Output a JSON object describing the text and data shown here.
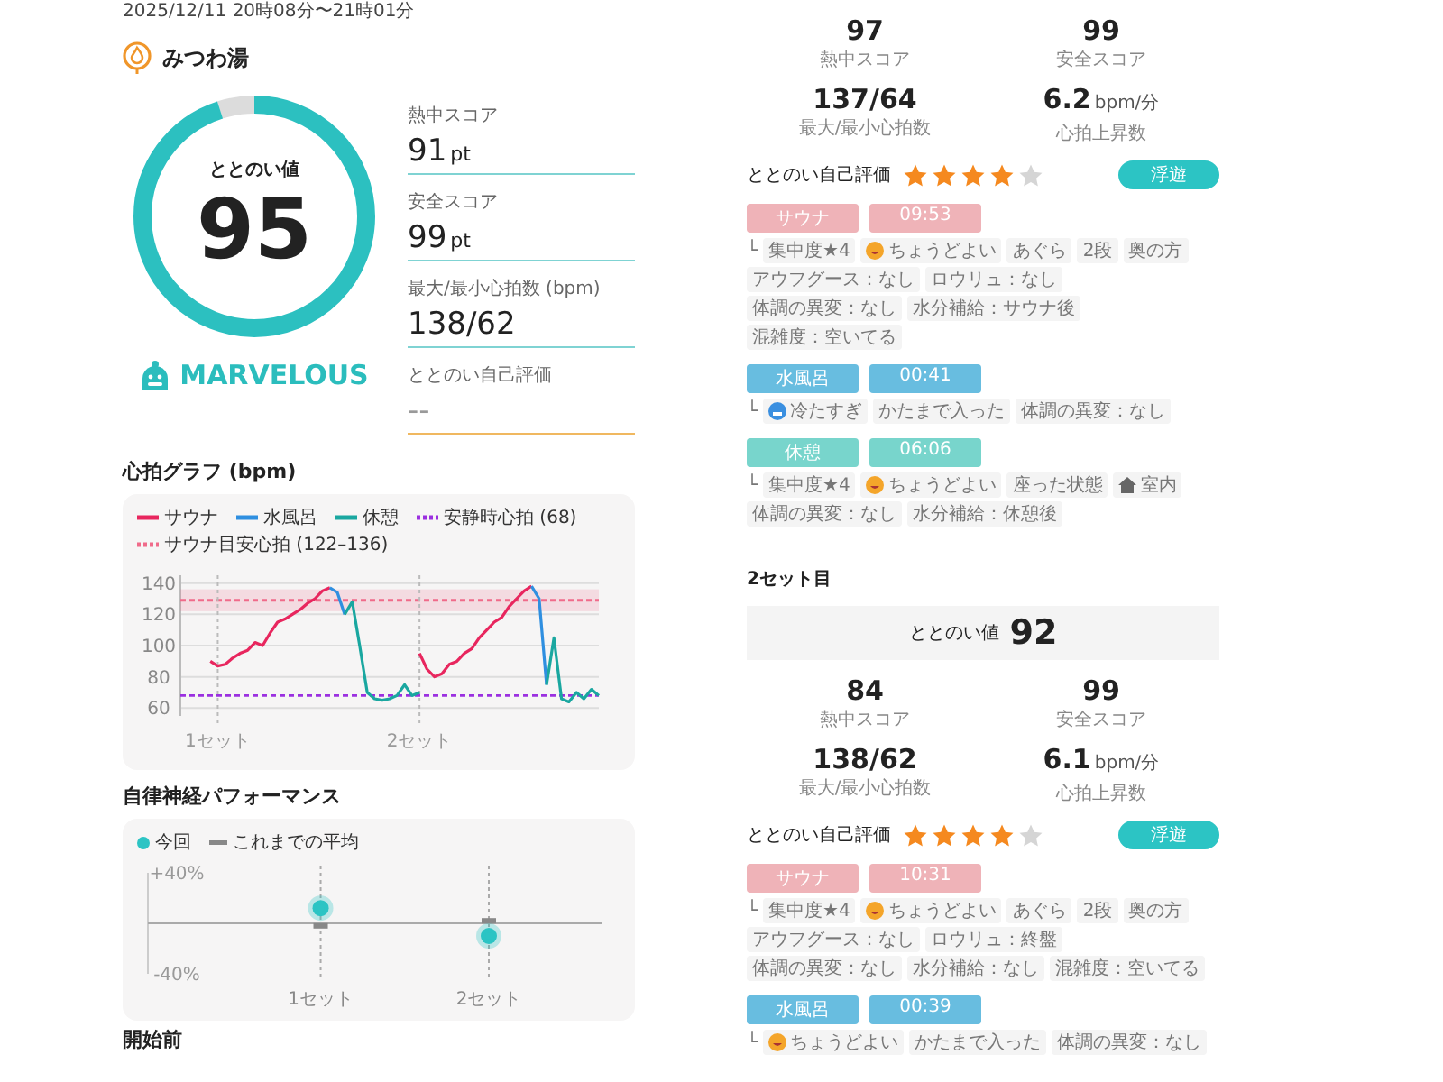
{
  "session": {
    "datetime": "2025/12/11 20時08分〜21時01分",
    "facility": "みつわ湯"
  },
  "summary": {
    "score_label": "ととのい値",
    "score": "95",
    "level": 0.95,
    "rank": "MARVELOUS",
    "fields": [
      {
        "kind": "score",
        "label": "熱中スコア",
        "value": "91",
        "unit": "pt"
      },
      {
        "kind": "score",
        "label": "安全スコア",
        "value": "99",
        "unit": "pt"
      },
      {
        "kind": "score",
        "label": "最大/最小心拍数 (bpm)",
        "value": "138/62"
      },
      {
        "kind": "rating",
        "label": "ととのい自己評価",
        "value": "--"
      }
    ]
  },
  "heart_chart": {
    "title": "心拍グラフ (bpm)",
    "chart_data": {
      "type": "line",
      "categories": [
        null,
        "1セット",
        null,
        null,
        null,
        null,
        null,
        null,
        null,
        null,
        null,
        null,
        null,
        null,
        null,
        null,
        null,
        null,
        null,
        null,
        null,
        null,
        null,
        null,
        null,
        null,
        null,
        null,
        "2セット",
        null,
        null,
        null,
        null,
        null,
        null,
        null,
        null,
        null,
        null,
        null,
        null,
        null,
        null,
        null,
        null,
        null,
        null,
        null,
        null,
        null,
        null,
        null,
        null
      ],
      "ylim": [
        55,
        145
      ],
      "yticks": [
        60,
        80,
        100,
        120,
        140
      ],
      "series": [
        {
          "name": "サウナ",
          "color": "#e8265e",
          "values": [
            90,
            87,
            88,
            92,
            95,
            97,
            102,
            100,
            108,
            115,
            117,
            120,
            123,
            127,
            130,
            135,
            137,
            null,
            null,
            null,
            null,
            null,
            null,
            null,
            null,
            null,
            null,
            null,
            95,
            85,
            80,
            82,
            88,
            90,
            95,
            98,
            105,
            110,
            115,
            118,
            125,
            130,
            135,
            138,
            null,
            null,
            null,
            null,
            null,
            null,
            null,
            null,
            null
          ]
        },
        {
          "name": "水風呂",
          "color": "#2f8fe0",
          "values": [
            null,
            null,
            null,
            null,
            null,
            null,
            null,
            null,
            null,
            null,
            null,
            null,
            null,
            null,
            null,
            null,
            137,
            134,
            120,
            null,
            null,
            null,
            null,
            null,
            null,
            null,
            null,
            null,
            null,
            null,
            null,
            null,
            null,
            null,
            null,
            null,
            null,
            null,
            null,
            null,
            null,
            null,
            null,
            138,
            130,
            75,
            null,
            null,
            null,
            null,
            null,
            null,
            null
          ]
        },
        {
          "name": "休憩",
          "color": "#1aa7a0",
          "values": [
            null,
            null,
            null,
            null,
            null,
            null,
            null,
            null,
            null,
            null,
            null,
            null,
            null,
            null,
            null,
            null,
            null,
            null,
            120,
            128,
            100,
            70,
            66,
            65,
            66,
            68,
            75,
            68,
            70,
            null,
            null,
            null,
            null,
            null,
            null,
            null,
            null,
            null,
            null,
            null,
            null,
            null,
            null,
            null,
            null,
            75,
            105,
            66,
            64,
            70,
            66,
            72,
            68
          ]
        }
      ],
      "grid": true,
      "ref_lines": [
        {
          "axis": "y",
          "value": 68,
          "label": "安静時心拍 (68)",
          "color": "#9b30e0"
        },
        {
          "axis": "y",
          "value": 129,
          "color": "#f06b8a"
        }
      ],
      "bands": [
        {
          "axis": "y",
          "from": 122,
          "to": 136,
          "label": "サウナ目安心拍 (122–136)",
          "color": "#f06b8a"
        }
      ]
    }
  },
  "autonomic_chart": {
    "title": "自律神経パフォーマンス",
    "chart_data": {
      "type": "scatter",
      "categories": [
        "1セット",
        "2セット"
      ],
      "ylim": [
        -40,
        40
      ],
      "yticks": [
        {
          "value": 40,
          "label": "+40%"
        },
        {
          "value": -40,
          "label": "-40%"
        }
      ],
      "series": [
        {
          "name": "今回",
          "color": "#2cc4c4",
          "values": [
            12,
            -10
          ]
        },
        {
          "name": "これまでの平均",
          "color": "#888888",
          "values": [
            -2,
            2
          ]
        }
      ]
    }
  },
  "next_section": {
    "title": "開始前"
  },
  "sets": [
    {
      "stats": [
        {
          "value": "97",
          "label": "熱中スコア"
        },
        {
          "value": "99",
          "label": "安全スコア"
        },
        {
          "value": "137/64",
          "label": "最大/最小心拍数"
        },
        {
          "value": "6.2",
          "unit": "bpm/分",
          "label": "心拍上昇数"
        }
      ],
      "rating": {
        "label": "ととのい自己評価",
        "stars": 4
      },
      "feeling": "浮遊",
      "steps": [
        {
          "kind": "sauna",
          "name": "サウナ",
          "time": "09:53",
          "branch": "└",
          "chips": [
            {
              "kind": "text",
              "text": "集中度★4"
            },
            {
              "kind": "mood",
              "text": "ちょうどよい"
            },
            {
              "kind": "text",
              "text": "あぐら"
            },
            {
              "kind": "text",
              "text": "2段"
            },
            {
              "kind": "text",
              "text": "奥の方"
            },
            {
              "kind": "text",
              "text": "アウフグース：なし"
            },
            {
              "kind": "text",
              "text": "ロウリュ：なし"
            },
            {
              "kind": "text",
              "text": "体調の異変：なし"
            },
            {
              "kind": "text",
              "text": "水分補給：サウナ後"
            },
            {
              "kind": "text",
              "text": "混雑度：空いてる"
            }
          ]
        },
        {
          "kind": "water",
          "name": "水風呂",
          "time": "00:41",
          "branch": "└",
          "chips": [
            {
              "kind": "chill",
              "text": "冷たすぎ"
            },
            {
              "kind": "text",
              "text": "かたまで入った"
            },
            {
              "kind": "text",
              "text": "体調の異変：なし"
            }
          ]
        },
        {
          "kind": "rest",
          "name": "休憩",
          "time": "06:06",
          "branch": "└",
          "chips": [
            {
              "kind": "text",
              "text": "集中度★4"
            },
            {
              "kind": "mood",
              "text": "ちょうどよい"
            },
            {
              "kind": "text",
              "text": "座った状態"
            },
            {
              "kind": "place",
              "text": "室内"
            },
            {
              "kind": "text",
              "text": "体調の異変：なし"
            },
            {
              "kind": "text",
              "text": "水分補給：休憩後"
            }
          ]
        }
      ]
    },
    {
      "title": "2セット目",
      "score_label": "ととのい値",
      "score": "92",
      "stats": [
        {
          "value": "84",
          "label": "熱中スコア"
        },
        {
          "value": "99",
          "label": "安全スコア"
        },
        {
          "value": "138/62",
          "label": "最大/最小心拍数"
        },
        {
          "value": "6.1",
          "unit": "bpm/分",
          "label": "心拍上昇数"
        }
      ],
      "rating": {
        "label": "ととのい自己評価",
        "stars": 4
      },
      "feeling": "浮遊",
      "steps": [
        {
          "kind": "sauna",
          "name": "サウナ",
          "time": "10:31",
          "branch": "└",
          "chips": [
            {
              "kind": "text",
              "text": "集中度★4"
            },
            {
              "kind": "mood",
              "text": "ちょうどよい"
            },
            {
              "kind": "text",
              "text": "あぐら"
            },
            {
              "kind": "text",
              "text": "2段"
            },
            {
              "kind": "text",
              "text": "奥の方"
            },
            {
              "kind": "text",
              "text": "アウフグース：なし"
            },
            {
              "kind": "text",
              "text": "ロウリュ：終盤"
            },
            {
              "kind": "text",
              "text": "体調の異変：なし"
            },
            {
              "kind": "text",
              "text": "水分補給：なし"
            },
            {
              "kind": "text",
              "text": "混雑度：空いてる"
            }
          ]
        },
        {
          "kind": "water",
          "name": "水風呂",
          "time": "00:39",
          "branch": "└",
          "chips": [
            {
              "kind": "mood",
              "text": "ちょうどよい"
            },
            {
              "kind": "text",
              "text": "かたまで入った"
            },
            {
              "kind": "text",
              "text": "体調の異変：なし"
            }
          ]
        }
      ]
    }
  ]
}
